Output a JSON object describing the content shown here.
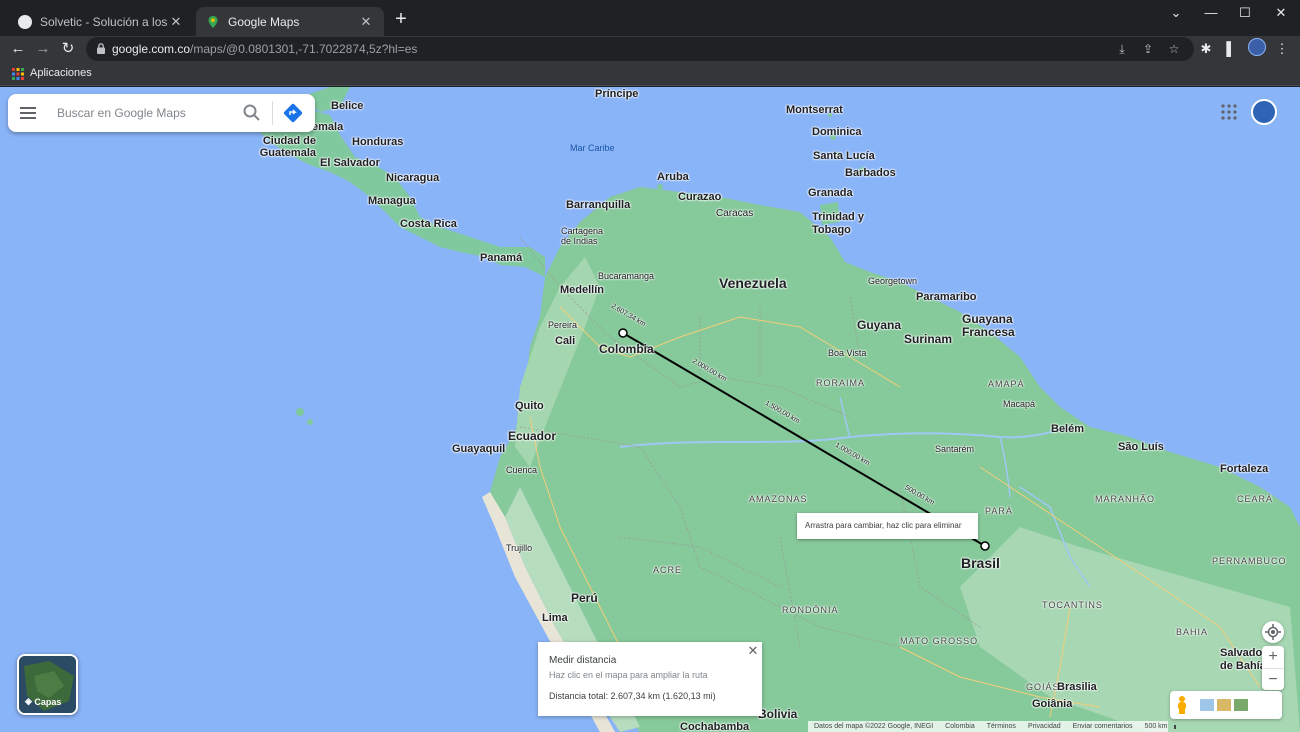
{
  "browser": {
    "tabs": [
      {
        "title": "Solvetic - Solución a los problem",
        "active": false
      },
      {
        "title": "Google Maps",
        "active": true
      }
    ],
    "url_domain": "google.com.co",
    "url_path": "/maps/@0.0801301,-71.7022874,5z?hl=es",
    "bookmarks_label": "Aplicaciones"
  },
  "maps": {
    "search_placeholder": "Buscar en Google Maps",
    "layers_label": "Capas",
    "tooltip": "Arrastra para cambiar, haz clic para eliminar",
    "measure": {
      "title": "Medir distancia",
      "subtitle": "Haz clic en el mapa para ampliar la ruta",
      "total": "Distancia total: 2.607,34 km (1.620,13 mi)"
    },
    "footer": [
      "Datos del mapa ©2022 Google, INEGI",
      "Colombia",
      "Términos",
      "Privacidad",
      "Enviar comentarios",
      "500 km"
    ],
    "scale_distances": [
      "2.607,34 km",
      "2.000,00 km",
      "1.500,00 km",
      "1.000,00 km",
      "500,00 km"
    ],
    "labels": {
      "principe": "Príncipe",
      "belize": "Belice",
      "guatemala_city": "emala",
      "honduras": "Honduras",
      "ciudad_guatemala": "Ciudad de Guatemala",
      "el_salvador": "El Salvador",
      "nicaragua": "Nicaragua",
      "managua": "Managua",
      "costa_rica": "Costa Rica",
      "panama": "Panamá",
      "mar_caribe": "Mar Caribe",
      "montserrat": "Montserrat",
      "dominica": "Dominica",
      "santa_lucia": "Santa Lucía",
      "barbados": "Barbados",
      "granada": "Granada",
      "aruba": "Aruba",
      "curazao": "Curazao",
      "barranquilla": "Barranquilla",
      "cartagena": "Cartagena de Indias",
      "caracas": "Caracas",
      "trinidad": "Trinidad y Tobago",
      "bucaramanga": "Bucaramanga",
      "venezuela": "Venezuela",
      "georgetown": "Georgetown",
      "paramaribo": "Paramaribo",
      "medellin": "Medellín",
      "guyana": "Guyana",
      "surinam": "Surinam",
      "guayana": "Guayana Francesa",
      "pereira": "Pereira",
      "cali": "Cali",
      "colombia": "Colombia",
      "boa_vista": "Boa Vista",
      "roraima": "RORAIMA",
      "amapa": "AMAPÁ",
      "macapa": "Macapá",
      "quito": "Quito",
      "ecuador": "Ecuador",
      "guayaquil": "Guayaquil",
      "cuenca": "Cuenca",
      "belem": "Belém",
      "sao_luis": "São Luís",
      "santarem": "Santarém",
      "fortaleza": "Fortaleza",
      "amazonas": "AMAZONAS",
      "maranhao": "MARANHÃO",
      "para": "PARÁ",
      "ceara": "CEARÁ",
      "brasil": "Brasil",
      "trujillo": "Trujillo",
      "acre": "ACRE",
      "peru": "Perú",
      "rondonia": "RONDÔNIA",
      "tocantins": "TOCANTINS",
      "lima": "Lima",
      "mato_grosso": "MATO GROSSO",
      "bahia": "BAHIA",
      "salvador": "Salvador de Bahía",
      "goias": "GOIÁS",
      "brasilia": "Brasilia",
      "goiania": "Goiânia",
      "bolivia": "Bolivia",
      "cochabamba": "Cochabamba",
      "pernambuco": "PERNAMBUCO"
    }
  }
}
